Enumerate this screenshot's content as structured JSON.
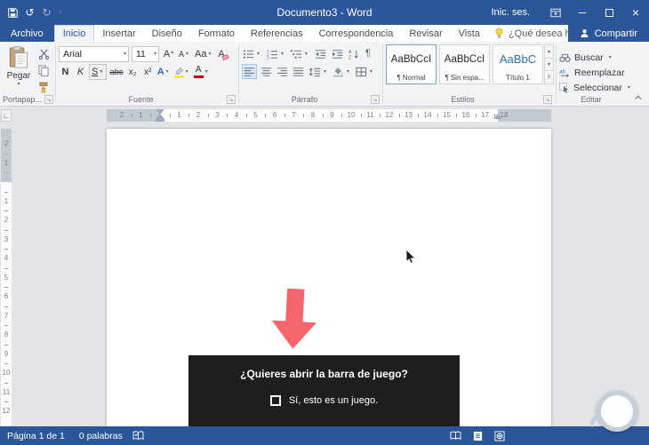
{
  "colors": {
    "accent": "#2b579a",
    "ribbon_bg": "#f1f3f5",
    "canvas_bg": "#e2e4e7",
    "page_bg": "#ffffff",
    "dialog_bg": "#1e1e1e",
    "arrow_color": "#f5656c",
    "heading_blue": "#2e74b5",
    "highlight_yellow": "#ffe34d",
    "font_color_red": "#c00000"
  },
  "icons": {
    "undo": "↺",
    "redo": "↻",
    "dropdown": "▾",
    "up": "▴",
    "minimize": "─",
    "close": "×",
    "pilcrow": "¶",
    "launcher": "↘",
    "more": "≡",
    "tab_stop": "∟"
  },
  "titlebar": {
    "title": "Documento3 - Word",
    "sign_in": "Inic. ses."
  },
  "tabs": {
    "file": "Archivo",
    "items": [
      {
        "label": "Inicio",
        "active": true
      },
      {
        "label": "Insertar",
        "active": false
      },
      {
        "label": "Diseño",
        "active": false
      },
      {
        "label": "Formato",
        "active": false
      },
      {
        "label": "Referencias",
        "active": false
      },
      {
        "label": "Correspondencia",
        "active": false
      },
      {
        "label": "Revisar",
        "active": false
      },
      {
        "label": "Vista",
        "active": false
      }
    ],
    "tell_me": "¿Qué desea hacer?",
    "share": "Compartir"
  },
  "ribbon": {
    "clipboard": {
      "label": "Portapap...",
      "paste": "Pegar"
    },
    "font": {
      "label": "Fuente",
      "name": "Arial",
      "size": "11",
      "grow": "A",
      "shrink": "A",
      "change_case": "Aa",
      "clear": "A",
      "bold": "N",
      "italic": "K",
      "underline": "S",
      "strike": "abc",
      "subscript": "x₂",
      "superscript": "x²",
      "effects": "A",
      "color": "A"
    },
    "paragraph": {
      "label": "Párrafo"
    },
    "styles": {
      "label": "Estilos",
      "items": [
        {
          "preview": "AaBbCcI",
          "name": "¶ Normal",
          "selected": true,
          "heading": false
        },
        {
          "preview": "AaBbCcI",
          "name": "¶ Sin espa...",
          "selected": false,
          "heading": false
        },
        {
          "preview": "AaBbC",
          "name": "Título 1",
          "selected": false,
          "heading": true
        }
      ]
    },
    "editing": {
      "label": "Editar",
      "find": "Buscar",
      "replace": "Reemplazar",
      "select": "Seleccionar"
    }
  },
  "ruler": {
    "h_numbers": [
      "1",
      "2",
      "3",
      "4",
      "5",
      "6",
      "7",
      "8",
      "9",
      "10",
      "11",
      "12",
      "13",
      "14",
      "15",
      "16",
      "17",
      "18"
    ],
    "h_margin_numbers": [
      "1",
      "2"
    ],
    "v_numbers": [
      "1",
      "2",
      "3",
      "4",
      "5",
      "6",
      "7",
      "8",
      "9",
      "10",
      "11",
      "12"
    ],
    "v_margin_numbers": [
      "1",
      "2"
    ]
  },
  "dialog": {
    "title": "¿Quieres abrir la barra de juego?",
    "checkbox_label": "Sí, esto es un juego."
  },
  "statusbar": {
    "page_info": "Página 1 de 1",
    "word_count": "0 palabras"
  }
}
